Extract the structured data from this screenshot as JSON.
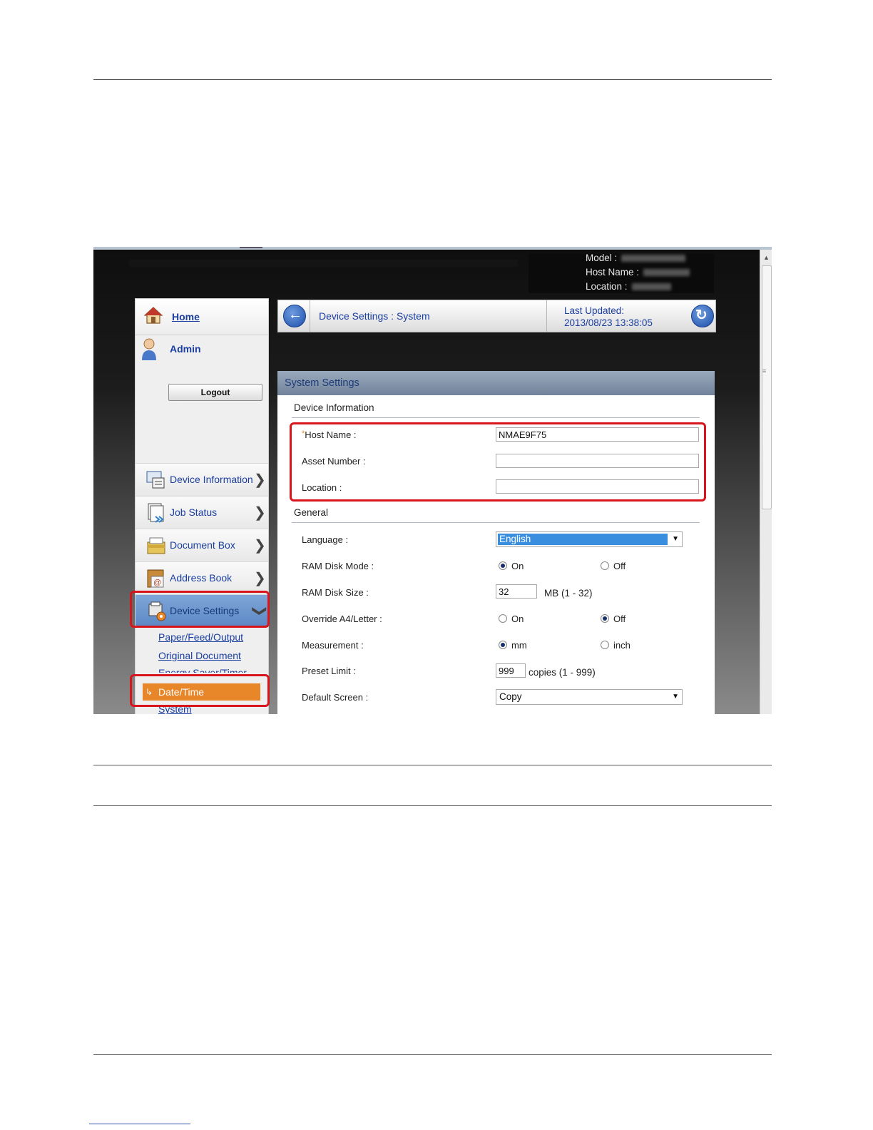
{
  "header": {
    "model_label": "Model :",
    "host_name_label": "Host Name :",
    "location_label": "Location :"
  },
  "sidebar": {
    "home": "Home",
    "admin": "Admin",
    "logout": "Logout",
    "items": [
      {
        "label": "Device Information"
      },
      {
        "label": "Job Status"
      },
      {
        "label": "Document Box"
      },
      {
        "label": "Address Book"
      },
      {
        "label": "Device Settings"
      }
    ],
    "subitems": [
      "Paper/Feed/Output",
      "Original Document",
      "Energy Saver/Timer",
      "Date/Time",
      "System"
    ],
    "selected_subitem": "Date/Time"
  },
  "breadcrumb": {
    "path": "Device Settings : System",
    "last_updated_label": "Last Updated:",
    "last_updated_value": "2013/08/23 13:38:05"
  },
  "panel": {
    "title": "System Settings",
    "device_info_section": "Device Information",
    "host_name_label": "Host Name :",
    "host_name_value": "NMAE9F75",
    "asset_number_label": "Asset Number :",
    "asset_number_value": "",
    "location_label": "Location :",
    "location_value": "",
    "general_section": "General",
    "language_label": "Language :",
    "language_value": "English",
    "ram_disk_mode_label": "RAM Disk Mode :",
    "ram_disk_mode_on": "On",
    "ram_disk_mode_off": "Off",
    "ram_disk_mode_selected": "On",
    "ram_disk_size_label": "RAM Disk Size :",
    "ram_disk_size_value": "32",
    "ram_disk_size_unit": "MB (1 - 32)",
    "override_label": "Override A4/Letter :",
    "override_on": "On",
    "override_off": "Off",
    "override_selected": "Off",
    "measurement_label": "Measurement :",
    "measurement_mm": "mm",
    "measurement_inch": "inch",
    "measurement_selected": "mm",
    "preset_limit_label": "Preset Limit :",
    "preset_limit_value": "999",
    "preset_limit_unit": "copies (1 - 999)",
    "default_screen_label": "Default Screen :",
    "default_screen_value": "Copy"
  },
  "colors": {
    "highlight_red": "#d8141c",
    "selected_orange": "#e8872a",
    "link_blue": "#1b3fa0"
  }
}
